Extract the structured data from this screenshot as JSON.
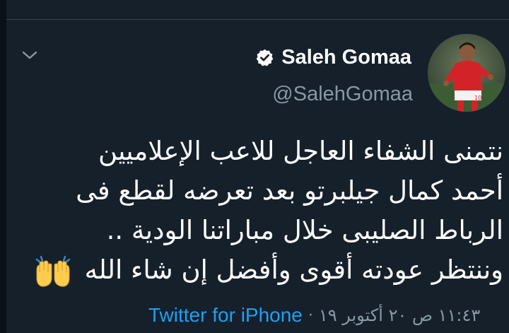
{
  "tweet": {
    "display_name": "Saleh Gomaa",
    "handle": "@SalehGomaa",
    "text_lines": [
      "نتمنى الشفاء العاجل للاعب الإعلاميين",
      "أحمد كمال جيلبرتو بعد تعرضه لقطع فى",
      "الرباط الصليبى خلال مباراتنا الودية ..",
      "وننتظر عودته أقوى وأفضل إن شاء الله"
    ],
    "emoji": "raising-hands",
    "source": "Twitter for iPhone",
    "timestamp": "١١:٤٣ ص ٢٠ أكتوبر ١٩",
    "verified": true
  },
  "colors": {
    "background": "#15202b",
    "primary_text": "#ffffff",
    "secondary_text": "#8899a6",
    "link": "#1da1f2"
  },
  "icons": {
    "chevron": "chevron-down-icon",
    "verified": "verified-badge-icon",
    "emoji": "raising-hands-emoji"
  }
}
